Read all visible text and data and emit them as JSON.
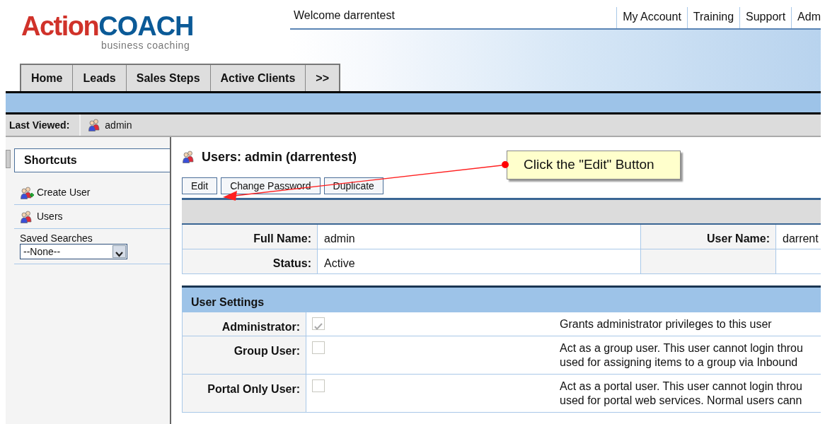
{
  "logo": {
    "word_1": "Action",
    "word_2": "COACH",
    "tagline": "business coaching"
  },
  "welcome": "Welcome darrentest",
  "top_links": [
    "My Account",
    "Training",
    "Support",
    "Adm"
  ],
  "tabs": [
    "Home",
    "Leads",
    "Sales Steps",
    "Active Clients",
    ">>"
  ],
  "last_viewed": {
    "label": "Last Viewed:",
    "item": "admin"
  },
  "sidebar": {
    "title": "Shortcuts",
    "items": [
      {
        "kind": "create",
        "label": "Create User"
      },
      {
        "kind": "users",
        "label": "Users"
      }
    ],
    "saved_searches": {
      "label": "Saved Searches",
      "value": "--None--"
    }
  },
  "page_title": "Users: admin (darrentest)",
  "buttons": [
    "Edit",
    "Change Password",
    "Duplicate"
  ],
  "details": [
    [
      {
        "label": "Full Name:",
        "value": "admin"
      },
      {
        "label": "User Name:",
        "value": "darrent"
      }
    ],
    [
      {
        "label": "Status:",
        "value": "Active"
      }
    ]
  ],
  "settings": {
    "title": "User Settings",
    "rows": [
      {
        "label": "Administrator:",
        "checked": true,
        "disabled": true,
        "description": [
          "Grants administrator privileges to this user"
        ]
      },
      {
        "label": "Group User:",
        "checked": false,
        "disabled": true,
        "description": [
          "Act as a group user. This user cannot login throu",
          "used for assigning items to a group via Inbound"
        ]
      },
      {
        "label": "Portal Only User:",
        "checked": false,
        "disabled": true,
        "description": [
          "Act as a portal user. This user cannot login throu",
          "used for portal web services. Normal users cann"
        ]
      }
    ]
  },
  "callout": {
    "text": "Click the \"Edit\" Button"
  }
}
